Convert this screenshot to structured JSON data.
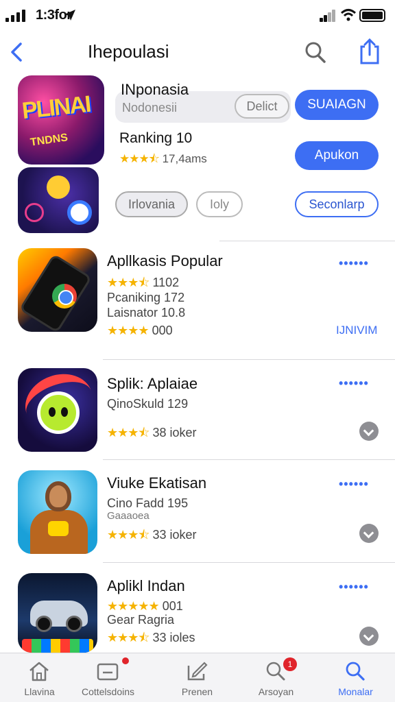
{
  "status_bar": {
    "time": "1:3for"
  },
  "nav": {
    "title": "Ihepoulasi"
  },
  "featured": {
    "name": "INponasia",
    "field_placeholder": "Nodonesii",
    "delete_label": "Delict",
    "search_button": "SUAIAGN",
    "ranking": "Ranking 10",
    "stars": "★★★⯪",
    "rating": "17,4ams",
    "apply_button": "Apukon",
    "chips": [
      "Irlovania",
      "Ioly",
      "Seconlarp"
    ]
  },
  "apps": [
    {
      "name": "Apllkasis Popular",
      "line1_stars": "★★★⯪",
      "line1_text": "1102",
      "line2": "Pcaniking 172",
      "line3": "Laisnator 10.8",
      "line4_stars": "★★★★",
      "line4_text": "000",
      "more": "••••••",
      "badge": "IJNIVIM"
    },
    {
      "name": "Splik: Aplaiae",
      "line1": "QinoSkuld 129",
      "line2_stars": "★★★⯪",
      "line2_text": "38 ioker",
      "more": "••••••"
    },
    {
      "name": "Viuke Ekatisan",
      "line1": "Cino Fadd 195",
      "line2": "Gaaaoea",
      "line3_stars": "★★★⯪",
      "line3_text": "33 ioker",
      "more": "••••••"
    },
    {
      "name": "Aplikl Indan",
      "line1_stars": "★★★★★",
      "line1_text": "001",
      "line2": "Gear Ragria",
      "line3_stars": "★★★⯪",
      "line3_text": "33 ioles",
      "more": "••••••"
    }
  ],
  "tabs": [
    {
      "label": "Llavina",
      "icon": "home-icon"
    },
    {
      "label": "Cottelsdoins",
      "icon": "inbox-icon",
      "dot": ""
    },
    {
      "label": "Prenen",
      "icon": "edit-icon"
    },
    {
      "label": "Arsoyan",
      "icon": "search-icon",
      "badge": "1"
    },
    {
      "label": "Monalar",
      "icon": "search-icon",
      "active": true
    }
  ],
  "colors": {
    "accent": "#3d6ef3",
    "star": "#f5b301",
    "badge": "#e0242b"
  }
}
